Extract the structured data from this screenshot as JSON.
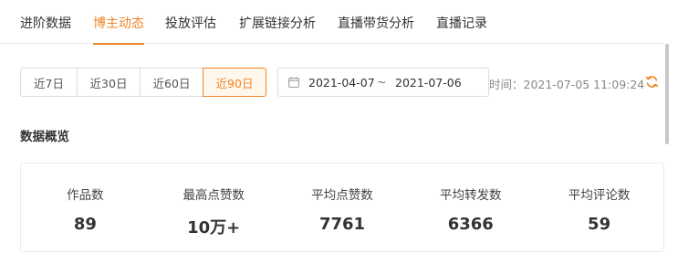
{
  "tabs": [
    {
      "label": "进阶数据",
      "active": false
    },
    {
      "label": "博主动态",
      "active": true
    },
    {
      "label": "投放评估",
      "active": false
    },
    {
      "label": "扩展链接分析",
      "active": false
    },
    {
      "label": "直播带货分析",
      "active": false
    },
    {
      "label": "直播记录",
      "active": false
    }
  ],
  "date_range": {
    "buttons": [
      {
        "label": "近7日",
        "active": false
      },
      {
        "label": "近30日",
        "active": false
      },
      {
        "label": "近60日",
        "active": false
      },
      {
        "label": "近90日",
        "active": true
      }
    ],
    "start": "2021-04-07",
    "separator": "~",
    "end": "2021-07-06"
  },
  "update_time": "时间：2021-07-05 11:09:24",
  "section_title": "数据概览",
  "stats": [
    {
      "label": "作品数",
      "value": "89"
    },
    {
      "label": "最高点赞数",
      "value": "10万+"
    },
    {
      "label": "平均点赞数",
      "value": "7761"
    },
    {
      "label": "平均转发数",
      "value": "6366"
    },
    {
      "label": "平均评论数",
      "value": "59"
    }
  ],
  "icons": {
    "calendar": "calendar-icon",
    "refresh": "refresh-icon"
  },
  "colors": {
    "accent": "#f0862a",
    "text": "#333333",
    "muted": "#888888",
    "border": "#dcdcdc"
  }
}
